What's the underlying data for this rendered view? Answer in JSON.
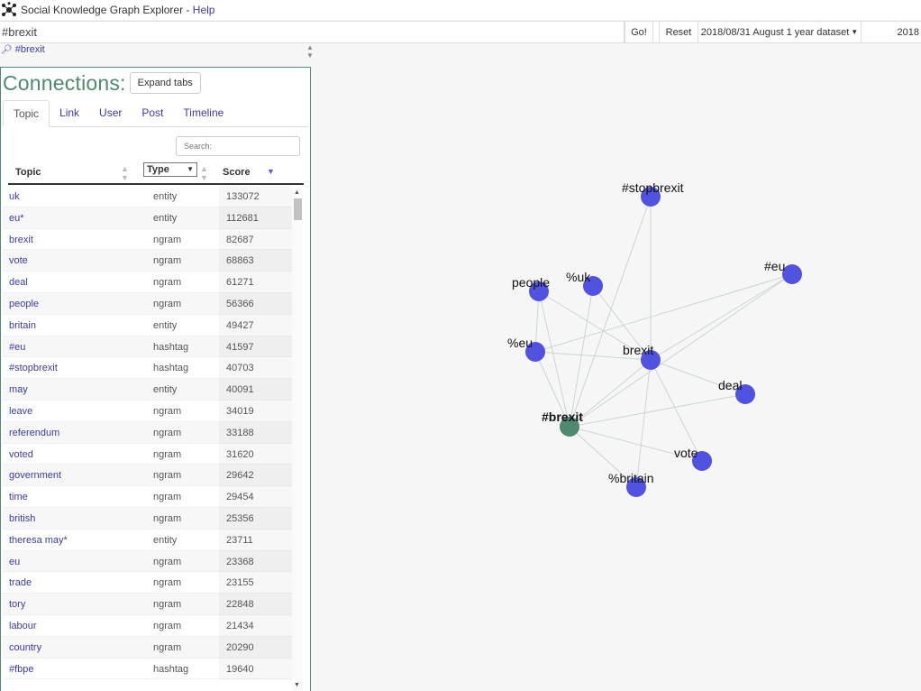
{
  "app": {
    "title": "Social Knowledge Graph Explorer",
    "separator": " - ",
    "help_label": "Help"
  },
  "query": {
    "value": "#brexit",
    "go_label": "Go!",
    "reset_label": "Reset",
    "dataset_label": "2018/08/31 August 1 year dataset",
    "date_partial": "2018"
  },
  "breadcrumb": {
    "icon": "search-icon",
    "text": "#brexit"
  },
  "panel": {
    "title": "Connections:",
    "expand_label": "Expand tabs",
    "tabs": [
      "Topic",
      "Link",
      "User",
      "Post",
      "Timeline"
    ],
    "active_tab": "Topic",
    "search_placeholder": "Search:",
    "columns": {
      "topic": "Topic",
      "type": "Type",
      "score": "Score"
    },
    "rows": [
      {
        "topic": "uk",
        "type": "entity",
        "score": "133072"
      },
      {
        "topic": "eu*",
        "type": "entity",
        "score": "112681"
      },
      {
        "topic": "brexit",
        "type": "ngram",
        "score": "82687"
      },
      {
        "topic": "vote",
        "type": "ngram",
        "score": "68863"
      },
      {
        "topic": "deal",
        "type": "ngram",
        "score": "61271"
      },
      {
        "topic": "people",
        "type": "ngram",
        "score": "56366"
      },
      {
        "topic": "britain",
        "type": "entity",
        "score": "49427"
      },
      {
        "topic": "#eu",
        "type": "hashtag",
        "score": "41597"
      },
      {
        "topic": "#stopbrexit",
        "type": "hashtag",
        "score": "40703"
      },
      {
        "topic": "may",
        "type": "entity",
        "score": "40091"
      },
      {
        "topic": "leave",
        "type": "ngram",
        "score": "34019"
      },
      {
        "topic": "referendum",
        "type": "ngram",
        "score": "33188"
      },
      {
        "topic": "voted",
        "type": "ngram",
        "score": "31620"
      },
      {
        "topic": "government",
        "type": "ngram",
        "score": "29642"
      },
      {
        "topic": "time",
        "type": "ngram",
        "score": "29454"
      },
      {
        "topic": "british",
        "type": "ngram",
        "score": "25356"
      },
      {
        "topic": "theresa may*",
        "type": "entity",
        "score": "23711"
      },
      {
        "topic": "eu",
        "type": "ngram",
        "score": "23368"
      },
      {
        "topic": "trade",
        "type": "ngram",
        "score": "23155"
      },
      {
        "topic": "tory",
        "type": "ngram",
        "score": "22848"
      },
      {
        "topic": "labour",
        "type": "ngram",
        "score": "21434"
      },
      {
        "topic": "country",
        "type": "ngram",
        "score": "20290"
      },
      {
        "topic": "#fbpe",
        "type": "hashtag",
        "score": "19640"
      }
    ]
  },
  "graph": {
    "colors": {
      "node": "#5252e0",
      "center": "#4f8a6e",
      "edge": "#c9d6d0"
    },
    "center_node": "#brexit",
    "nodes": [
      "#stopbrexit",
      "#eu",
      "people",
      "%uk",
      "%eu",
      "brexit",
      "deal",
      "#brexit",
      "vote",
      "%britain"
    ],
    "edges": [
      [
        "#brexit",
        "#stopbrexit"
      ],
      [
        "#brexit",
        "#eu"
      ],
      [
        "#brexit",
        "people"
      ],
      [
        "#brexit",
        "%uk"
      ],
      [
        "#brexit",
        "%eu"
      ],
      [
        "#brexit",
        "brexit"
      ],
      [
        "#brexit",
        "deal"
      ],
      [
        "#brexit",
        "vote"
      ],
      [
        "#brexit",
        "%britain"
      ],
      [
        "brexit",
        "#stopbrexit"
      ],
      [
        "brexit",
        "#eu"
      ],
      [
        "brexit",
        "people"
      ],
      [
        "brexit",
        "%uk"
      ],
      [
        "brexit",
        "%eu"
      ],
      [
        "brexit",
        "deal"
      ],
      [
        "brexit",
        "vote"
      ],
      [
        "brexit",
        "%britain"
      ],
      [
        "people",
        "%eu"
      ],
      [
        "%eu",
        "#eu"
      ]
    ]
  }
}
